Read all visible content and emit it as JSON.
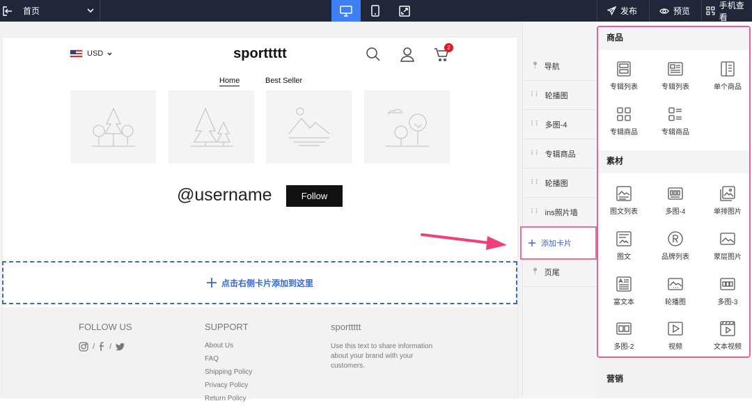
{
  "topbar": {
    "page_selector": "首页",
    "actions": [
      {
        "label": "发布",
        "icon": "send-icon"
      },
      {
        "label": "预览",
        "icon": "eye-icon"
      },
      {
        "label": "手机查看",
        "icon": "qrcode-icon"
      }
    ]
  },
  "shop": {
    "currency": "USD",
    "store_name": "sporttttt",
    "cart_count": "2",
    "nav": [
      "Home",
      "Best Seller"
    ],
    "username": "@username",
    "follow_label": "Follow",
    "dropzone_text": "点击右侧卡片添加到这里"
  },
  "footer": {
    "follow_heading": "FOLLOW US",
    "support_heading": "SUPPORT",
    "support_links": [
      "About Us",
      "FAQ",
      "Shipping Policy",
      "Privacy Policy",
      "Return Policy"
    ],
    "brand_heading": "sporttttt",
    "brand_text": "Use this text to share information about your brand with your customers.",
    "social_sep": "/"
  },
  "cards": [
    {
      "label": "导航",
      "handle": "pin"
    },
    {
      "label": "轮播图",
      "handle": "drag"
    },
    {
      "label": "多图-4",
      "handle": "drag"
    },
    {
      "label": "专辑商品",
      "handle": "drag"
    },
    {
      "label": "轮播图",
      "handle": "drag"
    },
    {
      "label": "ins照片墙",
      "handle": "drag"
    },
    {
      "label": "添加卡片",
      "handle": "plus"
    },
    {
      "label": "页尾",
      "handle": "pin"
    }
  ],
  "components": {
    "sections": [
      {
        "title": "商品",
        "items": [
          "专辑列表",
          "专辑列表",
          "单个商品",
          "专辑商品",
          "专辑商品"
        ]
      },
      {
        "title": "素材",
        "items": [
          "图文列表",
          "多图-4",
          "单排图片",
          "图文",
          "品牌列表",
          "蒙层图片",
          "富文本",
          "轮播图",
          "多图-3",
          "多图-2",
          "视频",
          "文本视频"
        ]
      },
      {
        "title": "营销",
        "items": []
      }
    ]
  },
  "colors": {
    "topbar": "#222639",
    "accent": "#3f7ff5",
    "highlight": "#e85f94",
    "dropzone": "#3566d8"
  }
}
